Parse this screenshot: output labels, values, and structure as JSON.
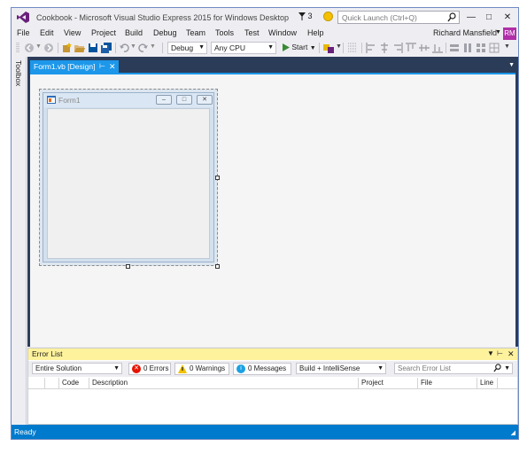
{
  "window": {
    "title": "Cookbook - Microsoft Visual Studio Express 2015 for Windows Desktop",
    "notification_count": "3",
    "quick_launch_placeholder": "Quick Launch (Ctrl+Q)"
  },
  "menu": {
    "items": [
      "File",
      "Edit",
      "View",
      "Project",
      "Build",
      "Debug",
      "Team",
      "Tools",
      "Test",
      "Window",
      "Help"
    ],
    "user_name": "Richard Mansfield",
    "user_initials": "RM"
  },
  "toolbar": {
    "configuration": "Debug",
    "platform": "Any CPU",
    "start_label": "Start"
  },
  "toolbox": {
    "label": "Toolbox"
  },
  "document": {
    "tab_label": "Form1.vb [Design]",
    "form_title": "Form1"
  },
  "error_list": {
    "title": "Error List",
    "scope": "Entire Solution",
    "errors_label": "0 Errors",
    "warnings_label": "0 Warnings",
    "messages_label": "0 Messages",
    "source": "Build + IntelliSense",
    "search_placeholder": "Search Error List",
    "columns": [
      "Code",
      "Description",
      "Project",
      "File",
      "Line"
    ]
  },
  "status": {
    "text": "Ready"
  },
  "colors": {
    "accent": "#007ACC",
    "tab_active": "#1C97EA",
    "doc_background": "#2B3C59",
    "error_title": "#FFF29D",
    "avatar": "#B02EA8"
  }
}
